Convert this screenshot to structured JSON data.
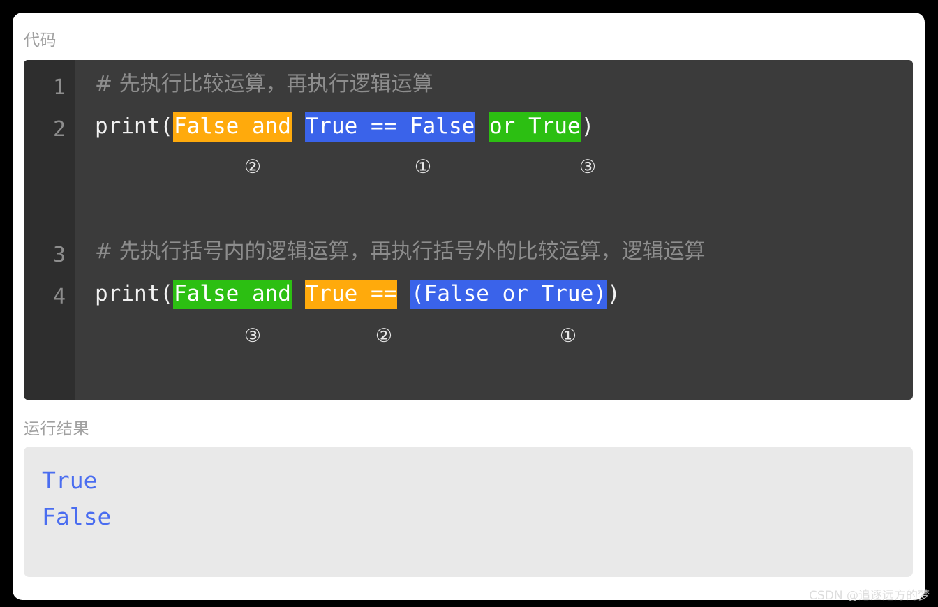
{
  "page": {
    "background_color": "#000000",
    "card_color": "#ffffff"
  },
  "sections": {
    "code_label": "代码",
    "result_label": "运行结果"
  },
  "colors": {
    "highlight_orange": "#ffaa0c",
    "highlight_blue": "#3a63ea",
    "highlight_green": "#2cbf12",
    "code_background": "#3b3b3b",
    "gutter_background": "#2e2e2e",
    "comment_text": "#8d8d8d",
    "code_text": "#f2f2f2",
    "result_background": "#e9e9e9",
    "result_text": "#4a6df0",
    "label_text": "#a0a0a0"
  },
  "code": {
    "line_numbers": [
      "1",
      "2",
      "3",
      "4"
    ],
    "line1": {
      "number": "1",
      "comment": "#  先执行比较运算，再执行逻辑运算"
    },
    "line2": {
      "number": "2",
      "prefix": "print(",
      "seg_orange": "False and",
      "gap1": " ",
      "seg_blue": "True == False",
      "gap2": " ",
      "seg_green": "or True",
      "suffix": ")",
      "markers": [
        "②",
        "①",
        "③"
      ]
    },
    "line3": {
      "number": "3",
      "comment": "#  先执行括号内的逻辑运算，再执行括号外的比较运算，逻辑运算"
    },
    "line4": {
      "number": "4",
      "prefix": "print(",
      "seg_green": "False and",
      "gap1": " ",
      "seg_orange": "True ==",
      "gap2": " ",
      "seg_blue": "(False or True)",
      "suffix": ")",
      "markers": [
        "③",
        "②",
        "①"
      ]
    }
  },
  "result": {
    "lines": [
      "True",
      "False"
    ]
  },
  "watermark": {
    "text": "CSDN @追逐远方的梦"
  }
}
